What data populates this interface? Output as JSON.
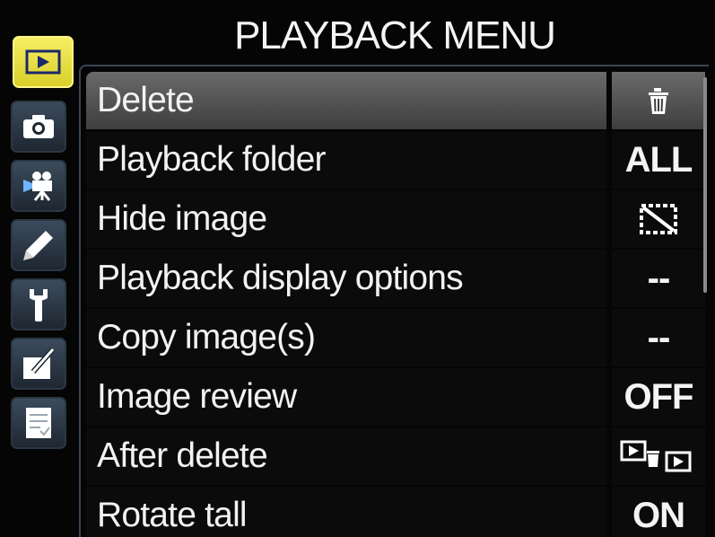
{
  "menu": {
    "title": "PLAYBACK MENU"
  },
  "tabs": [
    {
      "icon": "playback-icon",
      "active": true
    },
    {
      "icon": "camera-icon",
      "active": false
    },
    {
      "icon": "movie-icon",
      "active": false
    },
    {
      "icon": "pencil-icon",
      "active": false
    },
    {
      "icon": "wrench-icon",
      "active": false
    },
    {
      "icon": "retouch-icon",
      "active": false
    },
    {
      "icon": "recent-settings-icon",
      "active": false
    }
  ],
  "items": [
    {
      "label": "Delete",
      "value": "",
      "value_icon": "trash-icon",
      "selected": true
    },
    {
      "label": "Playback folder",
      "value": "ALL"
    },
    {
      "label": "Hide image",
      "value": "",
      "value_icon": "hide-image-icon"
    },
    {
      "label": "Playback display options",
      "value": "--"
    },
    {
      "label": "Copy image(s)",
      "value": "--"
    },
    {
      "label": "Image review",
      "value": "OFF"
    },
    {
      "label": "After delete",
      "value": "",
      "value_icon": "after-delete-icon"
    },
    {
      "label": "Rotate tall",
      "value": "ON"
    }
  ],
  "colors": {
    "background": "#050505",
    "active_tab": "#efe44a",
    "inactive_tab": "#2e3a48",
    "selected_row": "#555555",
    "text": "#f2f2f2"
  }
}
